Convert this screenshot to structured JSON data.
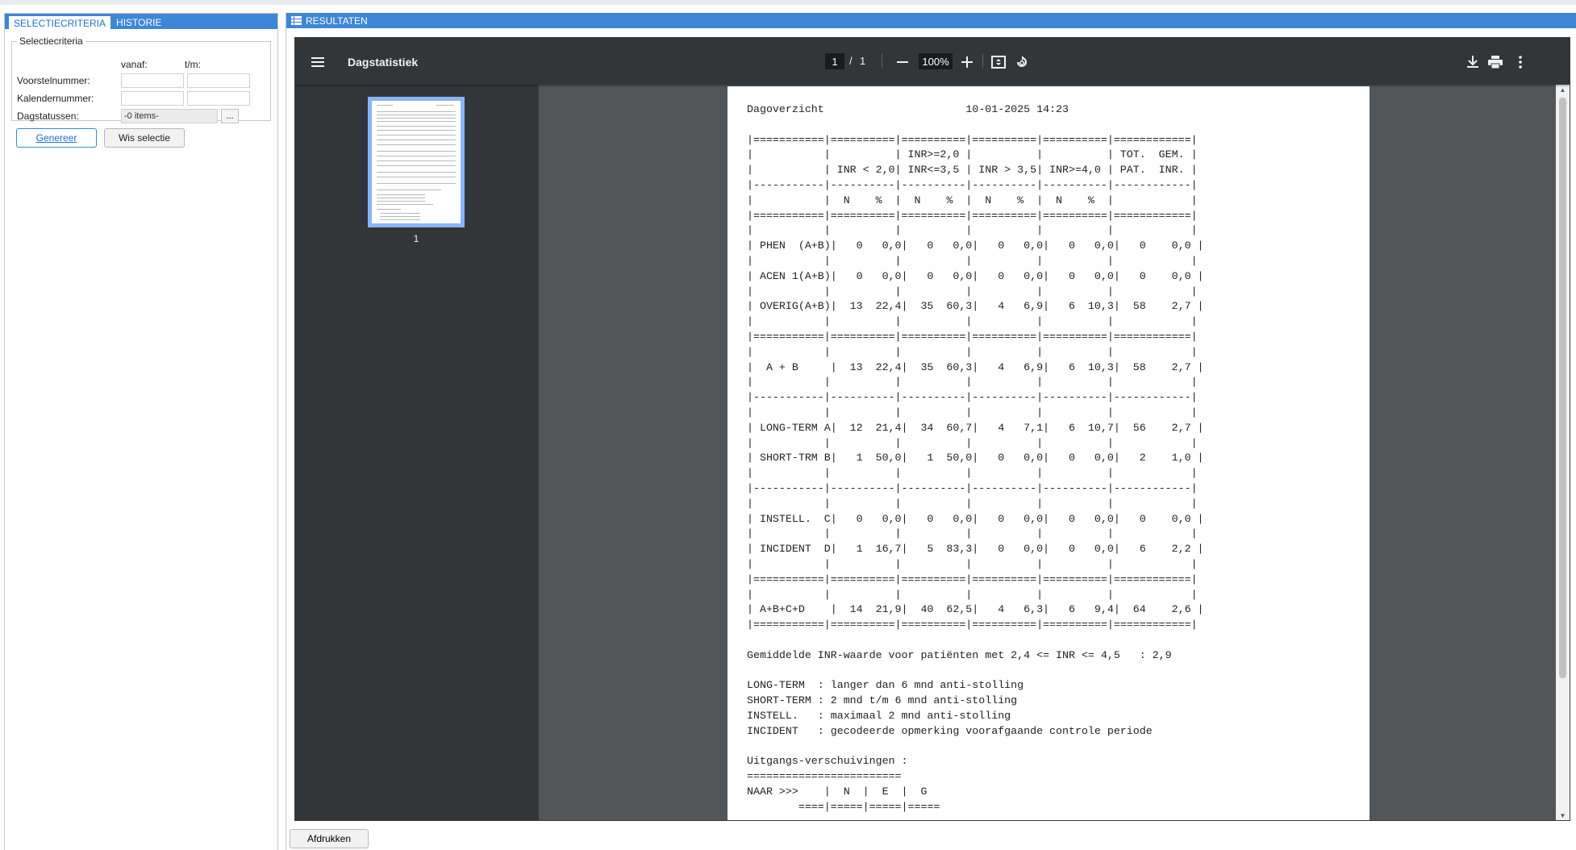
{
  "left": {
    "tabs": [
      {
        "label": "Selectiecriteria",
        "active": true
      },
      {
        "label": "Historie",
        "active": false
      }
    ],
    "legend": "Selectiecriteria",
    "col_from": "vanaf:",
    "col_to": "t/m:",
    "rows": {
      "voorstel": {
        "label": "Voorstelnummer:",
        "from": "",
        "to": ""
      },
      "kalender": {
        "label": "Kalendernummer:",
        "from": "",
        "to": ""
      },
      "dagstatus": {
        "label": "Dagstatussen:",
        "value": "-0 items-",
        "button": "..."
      }
    },
    "generate_label": "Genereer",
    "clear_label": "Wis selectie"
  },
  "right": {
    "header": "Resultaten",
    "print_label": "Afdrukken"
  },
  "viewer": {
    "title": "Dagstatistiek",
    "page_current": "1",
    "page_separator": "/",
    "page_total": "1",
    "zoom": "100%",
    "thumbnail_label": "1"
  },
  "report": {
    "header_left": "Dagoverzicht",
    "header_right": "10-01-2025 14:23",
    "table_rule_top": "|===========|==========|==========|==========|==========|============|",
    "table_head_1": "|           |          | INR>=2,0 |          |          | TOT.  GEM. |",
    "table_head_2": "|           | INR < 2,0| INR<=3,5 | INR > 3,5| INR>=4,0 | PAT.  INR. |",
    "table_rule_dash": "|-----------|----------|----------|----------|----------|------------|",
    "table_head_np": "|           |  N    %  |  N    %  |  N    %  |  N    %  |            |",
    "blank": "|           |          |          |          |          |            |",
    "row_phen": "| PHEN  (A+B)|   0   0,0|   0   0,0|   0   0,0|   0   0,0|   0    0,0 |",
    "row_acen": "| ACEN 1(A+B)|   0   0,0|   0   0,0|   0   0,0|   0   0,0|   0    0,0 |",
    "row_overig": "| OVERIG(A+B)|  13  22,4|  35  60,3|   4   6,9|   6  10,3|  58    2,7 |",
    "row_ab": "|  A + B     |  13  22,4|  35  60,3|   4   6,9|   6  10,3|  58    2,7 |",
    "row_long": "| LONG-TERM A|  12  21,4|  34  60,7|   4   7,1|   6  10,7|  56    2,7 |",
    "row_short": "| SHORT-TRM B|   1  50,0|   1  50,0|   0   0,0|   0   0,0|   2    1,0 |",
    "row_instell": "| INSTELL.  C|   0   0,0|   0   0,0|   0   0,0|   0   0,0|   0    0,0 |",
    "row_incident": "| INCIDENT  D|   1  16,7|   5  83,3|   0   0,0|   0   0,0|   6    2,2 |",
    "row_total": "| A+B+C+D    |  14  21,9|  40  62,5|   4   6,3|   6   9,4|  64    2,6 |",
    "avg_line": "Gemiddelde INR-waarde voor patiënten met 2,4 <= INR <= 4,5   : 2,9",
    "legend_long": "LONG-TERM  : langer dan 6 mnd anti-stolling",
    "legend_short": "SHORT-TERM : 2 mnd t/m 6 mnd anti-stolling",
    "legend_instell": "INSTELL.   : maximaal 2 mnd anti-stolling",
    "legend_incident": "INCIDENT   : gecodeerde opmerking voorafgaande controle periode",
    "shift_title": "Uitgangs-verschuivingen :",
    "shift_rule": "========================",
    "shift_head": "NAAR >>>    |  N  |  E  |  G",
    "shift_rule2": "        ====|=====|=====|====="
  },
  "colors": {
    "accent": "#3d86d8",
    "viewer_toolbar": "#323639",
    "viewer_bg": "#525659",
    "thumb_border": "#8ab4f8"
  }
}
